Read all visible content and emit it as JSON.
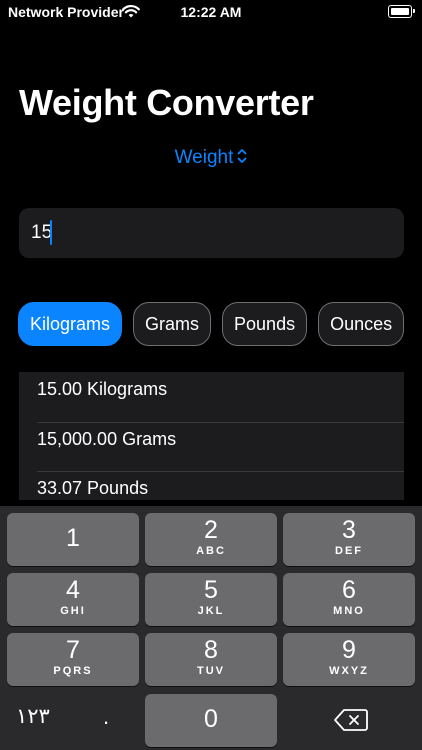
{
  "status_bar": {
    "carrier": "Network Provider",
    "time": "12:22 AM"
  },
  "title": "Weight Converter",
  "picker": {
    "label": "Weight"
  },
  "input": {
    "value": "15"
  },
  "units": [
    {
      "label": "Kilograms",
      "selected": true
    },
    {
      "label": "Grams",
      "selected": false
    },
    {
      "label": "Pounds",
      "selected": false
    },
    {
      "label": "Ounces",
      "selected": false
    }
  ],
  "results": [
    "15.00 Kilograms",
    "15,000.00 Grams",
    "33.07 Pounds"
  ],
  "keyboard": {
    "keys": [
      {
        "digit": "1",
        "letters": ""
      },
      {
        "digit": "2",
        "letters": "ABC"
      },
      {
        "digit": "3",
        "letters": "DEF"
      },
      {
        "digit": "4",
        "letters": "GHI"
      },
      {
        "digit": "5",
        "letters": "JKL"
      },
      {
        "digit": "6",
        "letters": "MNO"
      },
      {
        "digit": "7",
        "letters": "PQRS"
      },
      {
        "digit": "8",
        "letters": "TUV"
      },
      {
        "digit": "9",
        "letters": "WXYZ"
      },
      {
        "digit": "0",
        "letters": ""
      }
    ],
    "arabic_toggle": "١٢٣",
    "decimal": ".",
    "delete_icon": "delete-backward-icon"
  },
  "colors": {
    "accent": "#0a84ff",
    "background": "#000000",
    "field": "#1c1c1e",
    "key": "#6b6b6e",
    "keyboard_bg": "#2a2a2c"
  }
}
